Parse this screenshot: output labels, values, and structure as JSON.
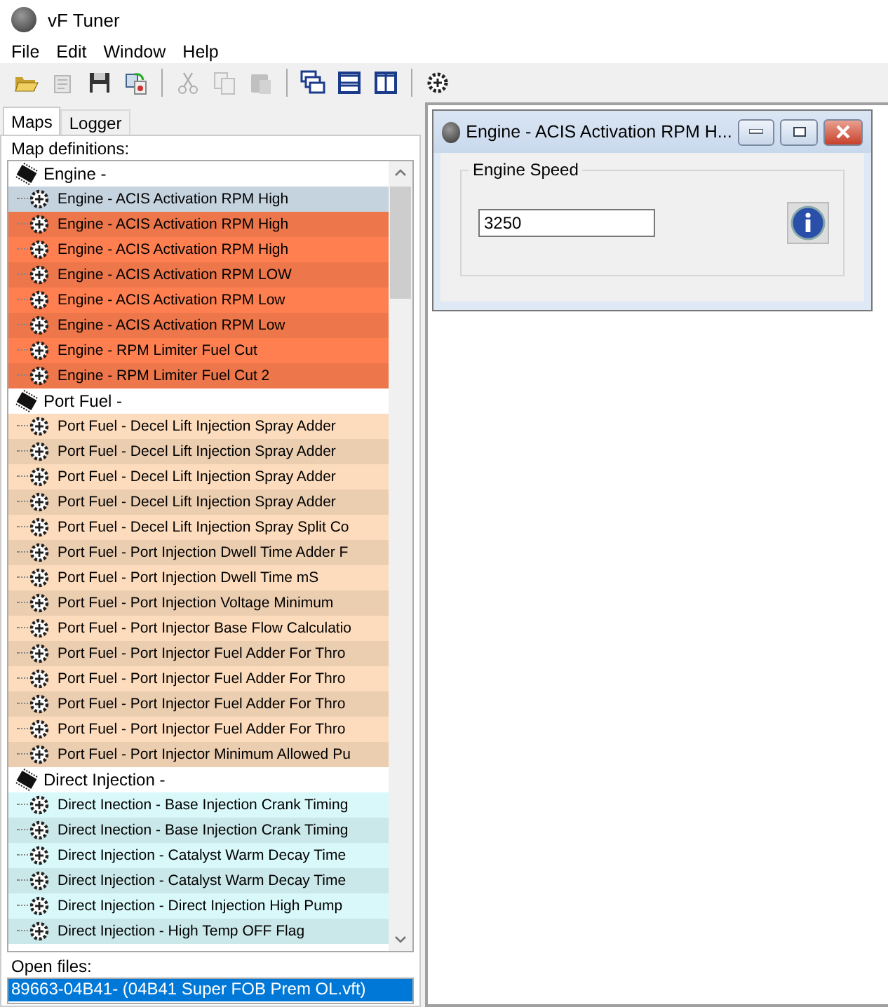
{
  "window": {
    "title": "vF Tuner"
  },
  "menu": [
    "File",
    "Edit",
    "Window",
    "Help"
  ],
  "toolbar": [
    {
      "kind": "open",
      "disabled": false
    },
    {
      "kind": "properties",
      "disabled": true
    },
    {
      "kind": "save",
      "disabled": false
    },
    {
      "kind": "convert",
      "disabled": false
    },
    {
      "kind": "sep"
    },
    {
      "kind": "cut",
      "disabled": true
    },
    {
      "kind": "copy",
      "disabled": true
    },
    {
      "kind": "paste",
      "disabled": true
    },
    {
      "kind": "sep"
    },
    {
      "kind": "cascade",
      "disabled": false
    },
    {
      "kind": "tile_h",
      "disabled": false
    },
    {
      "kind": "tile_v",
      "disabled": false
    },
    {
      "kind": "sep"
    },
    {
      "kind": "gear",
      "disabled": false
    }
  ],
  "tabs": [
    {
      "label": "Maps",
      "selected": true
    },
    {
      "label": "Logger",
      "selected": false
    }
  ],
  "map_definitions": {
    "label": "Map definitions:",
    "groups": [
      {
        "label": "Engine -",
        "color": "#ff7f50",
        "items": [
          {
            "label": "Engine - ACIS Activation RPM High",
            "selected": true
          },
          {
            "label": "Engine - ACIS Activation RPM High",
            "selected": false
          },
          {
            "label": "Engine - ACIS Activation RPM High",
            "selected": false
          },
          {
            "label": "Engine - ACIS Activation RPM LOW",
            "selected": false
          },
          {
            "label": "Engine - ACIS Activation RPM Low",
            "selected": false
          },
          {
            "label": "Engine - ACIS Activation RPM Low",
            "selected": false
          },
          {
            "label": "Engine - RPM Limiter Fuel Cut",
            "selected": false
          },
          {
            "label": "Engine - RPM Limiter Fuel Cut 2",
            "selected": false
          }
        ]
      },
      {
        "label": "Port Fuel -",
        "color": "#fddcbd",
        "items": [
          {
            "label": "Port Fuel - Decel Lift Injection Spray Adder",
            "selected": false
          },
          {
            "label": "Port Fuel - Decel Lift Injection Spray Adder",
            "selected": false
          },
          {
            "label": "Port Fuel - Decel Lift Injection Spray Adder",
            "selected": false
          },
          {
            "label": "Port Fuel - Decel Lift Injection Spray Adder",
            "selected": false
          },
          {
            "label": "Port Fuel - Decel Lift Injection Spray Split Co",
            "selected": false
          },
          {
            "label": "Port Fuel - Port Injection Dwell Time Adder F",
            "selected": false
          },
          {
            "label": "Port Fuel - Port Injection Dwell Time mS",
            "selected": false
          },
          {
            "label": "Port Fuel - Port Injection Voltage Minimum",
            "selected": false
          },
          {
            "label": "Port Fuel - Port Injector Base Flow Calculatio",
            "selected": false
          },
          {
            "label": "Port Fuel - Port Injector Fuel Adder For Thro",
            "selected": false
          },
          {
            "label": "Port Fuel - Port Injector Fuel Adder For Thro",
            "selected": false
          },
          {
            "label": "Port Fuel - Port Injector Fuel Adder For Thro",
            "selected": false
          },
          {
            "label": "Port Fuel - Port Injector Fuel Adder For Thro",
            "selected": false
          },
          {
            "label": "Port Fuel - Port Injector Minimum Allowed Pu",
            "selected": false
          }
        ]
      },
      {
        "label": "Direct Injection -",
        "color": "#d9f8fa",
        "items": [
          {
            "label": "Direct Inection - Base Injection Crank Timing",
            "selected": false
          },
          {
            "label": "Direct Inection - Base Injection Crank Timing",
            "selected": false
          },
          {
            "label": "Direct Injection - Catalyst Warm Decay Time",
            "selected": false
          },
          {
            "label": "Direct Injection - Catalyst Warm Decay Time",
            "selected": false
          },
          {
            "label": "Direct Injection - Direct Injection High Pump",
            "selected": false
          },
          {
            "label": "Direct Injection - High Temp OFF Flag",
            "selected": false
          }
        ]
      }
    ]
  },
  "open_files": {
    "label": "Open files:",
    "items": [
      {
        "label": "89663-04B41- (04B41 Super FOB Prem OL.vft)",
        "selected": true
      }
    ]
  },
  "child_window": {
    "title": "Engine - ACIS Activation RPM H...",
    "group_label": "Engine Speed",
    "value": "3250"
  }
}
